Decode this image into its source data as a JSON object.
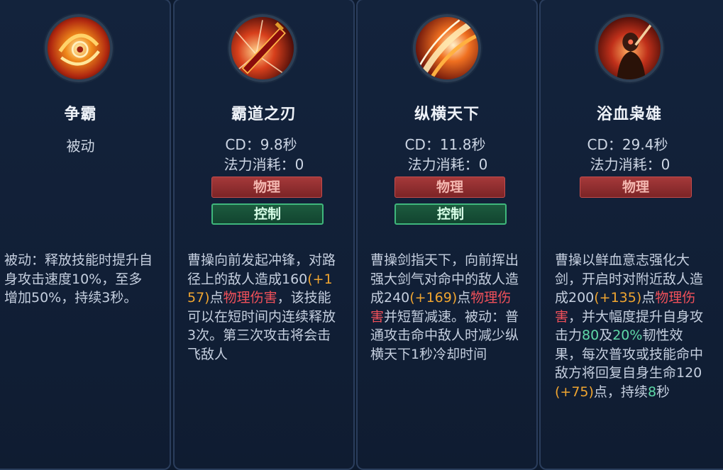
{
  "skills": [
    {
      "name": "争霸",
      "passive_label": "被动",
      "desc": [
        {
          "t": "被动：释放技能时提升自身攻击速度10%，至多增加50%，持续3秒。"
        }
      ]
    },
    {
      "name": "霸道之刃",
      "cd": "CD：9.8秒",
      "mana": "法力消耗：0",
      "tags": [
        "物理",
        "控制"
      ],
      "desc_parts": {
        "p1": "曹操向前发起冲锋，对路径上的敌人造成160",
        "p2": "(+157)",
        "p3": "点",
        "p4": "物理伤害",
        "p5": "，该技能可以在短时间内连续释放3次。第三次攻击将会击飞敌人"
      }
    },
    {
      "name": "纵横天下",
      "cd": "CD：11.8秒",
      "mana": "法力消耗：0",
      "tags": [
        "物理",
        "控制"
      ],
      "desc_parts": {
        "p1": "曹操剑指天下，向前挥出强大剑气对命中的敌人造成240",
        "p2": "(+169)",
        "p3": "点",
        "p4": "物理伤害",
        "p5": "并短暂减速。被动：普通攻击命中敌人时减少纵横天下1秒冷却时间"
      }
    },
    {
      "name": "浴血枭雄",
      "cd": "CD：29.4秒",
      "mana": "法力消耗：0",
      "tags": [
        "物理"
      ],
      "desc_parts": {
        "p1": "曹操以鲜血意志强化大剑，开启时对附近敌人造成200",
        "p2": "(+135)",
        "p3": "点",
        "p4": "物理伤害",
        "p5": "，并大幅度提升自身攻击力",
        "p6": "80",
        "p7": "及",
        "p8": "20%",
        "p9": "韧性效果，每次普攻或技能命中敌方将回复自身生命120",
        "p10": "(+75)",
        "p11": "点，持续",
        "p12": "8",
        "p13": "秒"
      }
    }
  ],
  "colors": {
    "bonus": "#f0a530",
    "physical": "#f0505a",
    "buff": "#5fd9a8"
  },
  "icons": [
    "spiral-slash-skill-icon",
    "blade-charge-skill-icon",
    "sword-wave-skill-icon",
    "bloodlust-hero-skill-icon"
  ]
}
